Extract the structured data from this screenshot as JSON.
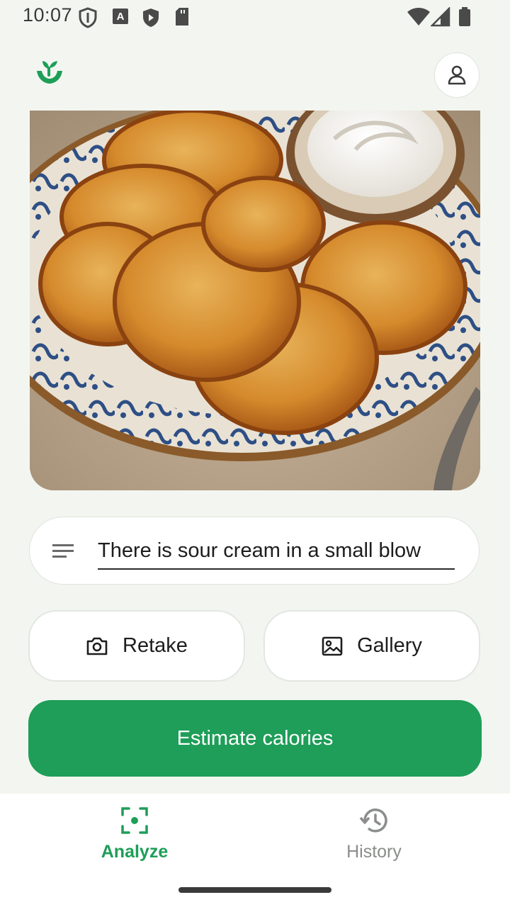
{
  "status_bar": {
    "time": "10:07"
  },
  "header": {
    "logo_icon": "sprout-logo-icon",
    "profile_icon": "person-icon"
  },
  "photo": {
    "icon": "food-photo"
  },
  "prompt": {
    "value": "There is sour cream in a small blow",
    "icon": "notes-icon"
  },
  "actions": {
    "retake_label": "Retake",
    "retake_icon": "camera-icon",
    "gallery_label": "Gallery",
    "gallery_icon": "image-icon",
    "estimate_label": "Estimate calories"
  },
  "nav": {
    "analyze_label": "Analyze",
    "analyze_icon": "scan-icon",
    "history_label": "History",
    "history_icon": "history-icon"
  },
  "colors": {
    "accent": "#1e9e58",
    "background": "#f3f6f0",
    "inactive": "#8a8d8a"
  }
}
